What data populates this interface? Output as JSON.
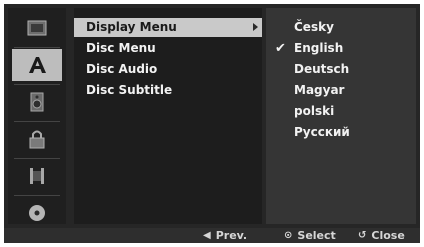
{
  "sidebar": {
    "tabs": [
      {
        "icon": "general-settings-icon",
        "active": false
      },
      {
        "icon": "language-icon",
        "active": true
      },
      {
        "icon": "audio-speaker-icon",
        "active": false
      },
      {
        "icon": "lock-icon",
        "active": false
      },
      {
        "icon": "film-icon",
        "active": false
      },
      {
        "icon": "disc-icon",
        "active": false
      }
    ]
  },
  "menu": {
    "items": [
      {
        "label": "Display Menu",
        "selected": true
      },
      {
        "label": "Disc Menu",
        "selected": false
      },
      {
        "label": "Disc Audio",
        "selected": false
      },
      {
        "label": "Disc Subtitle",
        "selected": false
      }
    ]
  },
  "languages": {
    "options": [
      {
        "label": "Česky",
        "checked": false
      },
      {
        "label": "English",
        "checked": true
      },
      {
        "label": "Deutsch",
        "checked": false
      },
      {
        "label": "Magyar",
        "checked": false
      },
      {
        "label": "polski",
        "checked": false
      },
      {
        "label": "Русский",
        "checked": false
      }
    ]
  },
  "footer": {
    "prev": "Prev.",
    "select": "Select",
    "close": "Close"
  },
  "colors": {
    "background": "#262626",
    "highlight": "#c9c9c9",
    "text": "#f2f2f2"
  }
}
